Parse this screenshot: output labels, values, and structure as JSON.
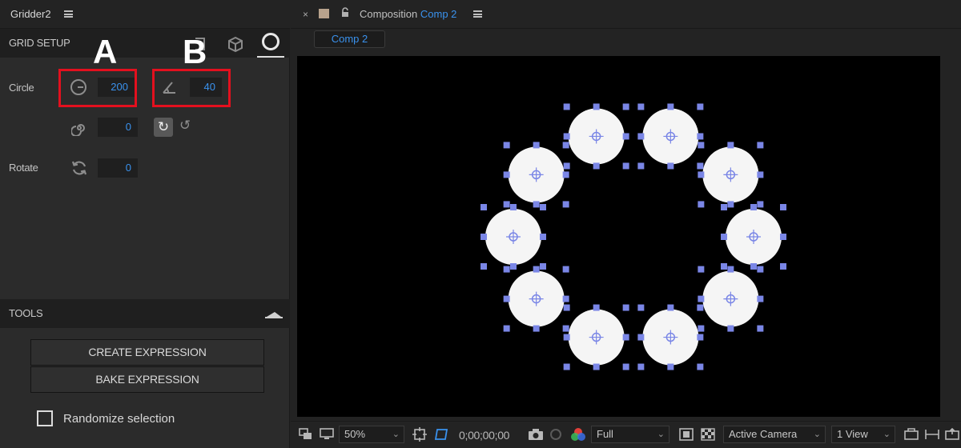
{
  "left_panel": {
    "title": "Gridder2",
    "grid_setup_label": "GRID SETUP",
    "annotation_a": "A",
    "annotation_b": "B",
    "circle_label": "Circle",
    "radius_value": "200",
    "angle_value": "40",
    "spiral_value": "0",
    "rotate_label": "Rotate",
    "rotate_value": "0",
    "tools_label": "TOOLS",
    "create_expression_label": "CREATE EXPRESSION",
    "bake_expression_label": "BAKE EXPRESSION",
    "randomize_label": "Randomize selection",
    "randomize_checked": false
  },
  "right_panel": {
    "close_glyph": "×",
    "header_prefix": "Composition",
    "header_comp_name": "Comp 2",
    "tab_label": "Comp 2",
    "toolbar": {
      "zoom": "50%",
      "timecode": "0;00;00;00",
      "resolution": "Full",
      "camera": "Active Camera",
      "views": "1 View"
    }
  },
  "colors": {
    "accent_blue": "#3a92ee",
    "highlight_red": "#e3101e",
    "handle_blue": "#7a86e6",
    "panel_bg": "#2b2b2b",
    "viewer_bg": "#000000"
  },
  "icons": [
    "menu-icon",
    "radius-icon",
    "angle-icon",
    "spiral-icon",
    "rotate-icon",
    "clockwise-icon",
    "counterclockwise-icon",
    "square-mode-icon",
    "cube-mode-icon",
    "circle-mode-icon",
    "lock-icon",
    "camera-icon",
    "collapse-icon"
  ],
  "viewer": {
    "layer_count": 10
  }
}
